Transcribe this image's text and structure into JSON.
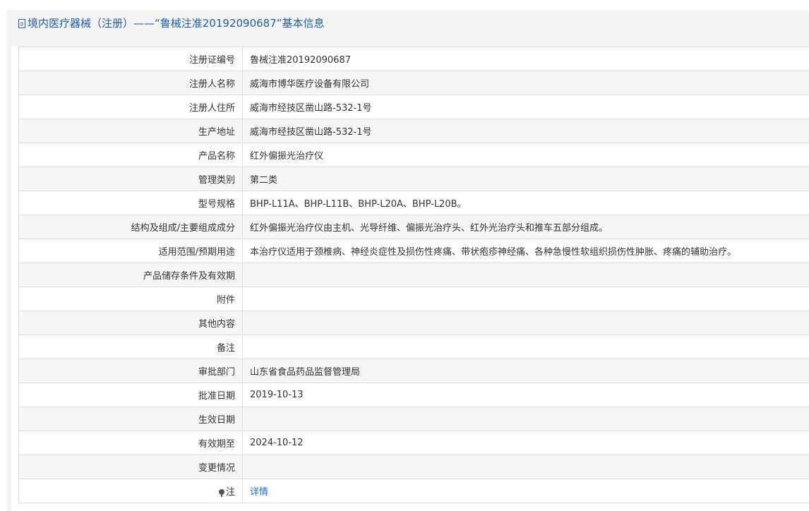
{
  "header": {
    "title": "境内医疗器械（注册）——“鲁械注准20192090687”基本信息",
    "icon": "document-icon"
  },
  "rows": [
    {
      "label": "注册证编号",
      "value": "鲁械注准20192090687"
    },
    {
      "label": "注册人名称",
      "value": "威海市博华医疗设备有限公司"
    },
    {
      "label": "注册人住所",
      "value": "威海市经技区凿山路-532-1号"
    },
    {
      "label": "生产地址",
      "value": "威海市经技区凿山路-532-1号"
    },
    {
      "label": "产品名称",
      "value": "红外偏振光治疗仪"
    },
    {
      "label": "管理类别",
      "value": "第二类"
    },
    {
      "label": "型号规格",
      "value": "BHP-L11A、BHP-L11B、BHP-L20A、BHP-L20B。"
    },
    {
      "label": "结构及组成/主要组成成分",
      "value": "红外偏振光治疗仪由主机、光导纤维、偏振光治疗头、红外光治疗头和推车五部分组成。"
    },
    {
      "label": "适用范围/预期用途",
      "value": "本治疗仪适用于颈椎病、神经炎症性及损伤性疼痛、带状疱疹神经痛、各种急慢性软组织损伤性肿胀、疼痛的辅助治疗。"
    },
    {
      "label": "产品储存条件及有效期",
      "value": ""
    },
    {
      "label": "附件",
      "value": ""
    },
    {
      "label": "其他内容",
      "value": ""
    },
    {
      "label": "备注",
      "value": ""
    },
    {
      "label": "审批部门",
      "value": "山东省食品药品监督管理局"
    },
    {
      "label": "批准日期",
      "value": "2019-10-13"
    },
    {
      "label": "生效日期",
      "value": ""
    },
    {
      "label": "有效期至",
      "value": "2024-10-12"
    },
    {
      "label": "变更情况",
      "value": ""
    }
  ],
  "note_row": {
    "label": "注",
    "link_text": "详情",
    "icon": "pin-icon"
  }
}
